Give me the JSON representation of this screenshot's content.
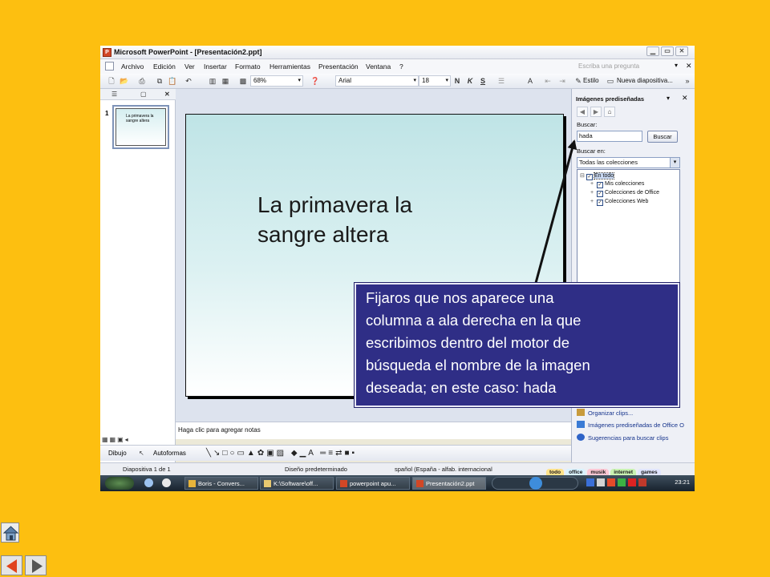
{
  "window": {
    "title": "Microsoft PowerPoint - [Presentación2.ppt]"
  },
  "menu": {
    "items": [
      "Archivo",
      "Edición",
      "Ver",
      "Insertar",
      "Formato",
      "Herramientas",
      "Presentación",
      "Ventana",
      "?"
    ],
    "ask_placeholder": "Escriba una pregunta"
  },
  "toolbar": {
    "zoom": "68%",
    "font": "Arial",
    "size": "18",
    "bold": "N",
    "italic": "K",
    "strike": "S",
    "style_label": "Estilo",
    "new_slide_label": "Nueva diapositiva..."
  },
  "slides_pane": {
    "slide_number": "1",
    "thumb_text": "La primavera la sangre altera"
  },
  "slide": {
    "title_line1": "La primavera la",
    "title_line2": "sangre altera"
  },
  "notes": {
    "placeholder": "Haga clic para agregar notas"
  },
  "task_pane": {
    "title": "Imágenes prediseñadas",
    "search_label": "Buscar:",
    "search_value": "hada",
    "search_button": "Buscar",
    "search_in_label": "Buscar en:",
    "search_in_value": "Todas las colecciones",
    "tree": [
      {
        "label": "En todo"
      },
      {
        "label": "Mis colecciones"
      },
      {
        "label": "Colecciones de Office"
      },
      {
        "label": "Colecciones Web"
      }
    ],
    "links": [
      "Organizar clips...",
      "Imágenes prediseñadas de Office O",
      "Sugerencias para buscar clips"
    ]
  },
  "drawing": {
    "draw_label": "Dibujo",
    "autoshapes_label": "Autoformas"
  },
  "status": {
    "slide": "Diapositiva 1 de 1",
    "design": "Diseño predeterminado",
    "language": "spañol (España - alfab. internacional"
  },
  "music_tabs": [
    "todo",
    "office",
    "musik",
    "internet",
    "games"
  ],
  "taskbar": {
    "tasks": [
      "Boris - Convers...",
      "K:\\Software\\off...",
      "powerpoint apu...",
      "Presentación2.ppt"
    ],
    "clock": "23:21"
  },
  "callout": {
    "lines": [
      "Fijaros que nos aparece una",
      "columna a ala derecha en la que",
      "escribimos dentro del motor de",
      "búsqueda el nombre de la imagen",
      "deseada; en este caso: hada"
    ]
  },
  "colors": {
    "background": "#FDBF10",
    "callout": "#2F2E86",
    "nav_arrow": "#E0431E"
  }
}
